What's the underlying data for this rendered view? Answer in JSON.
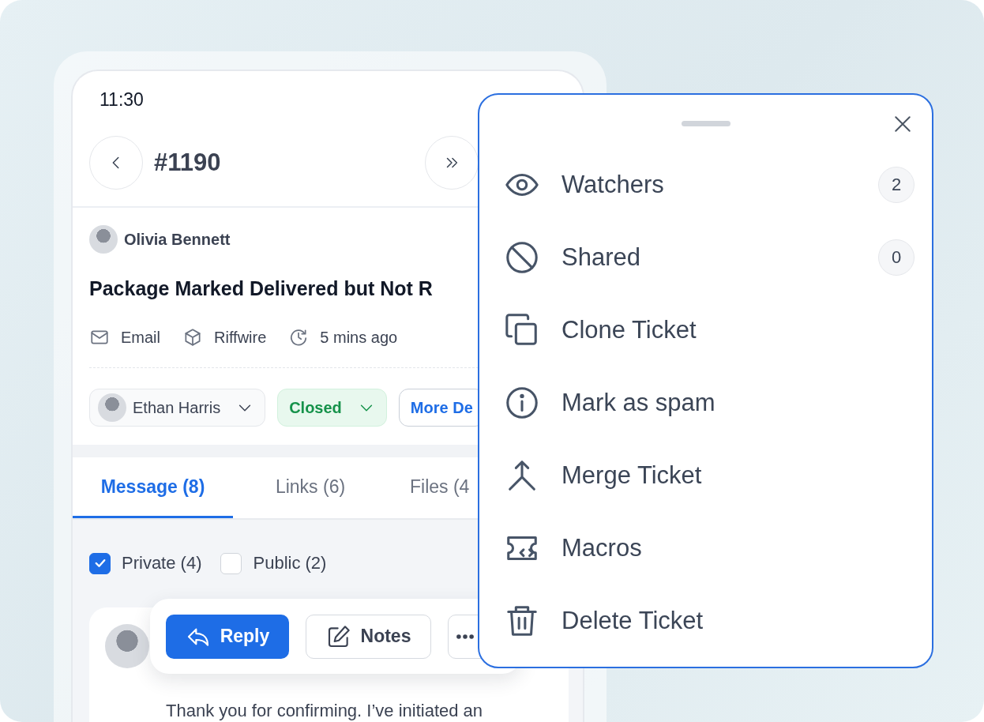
{
  "status_bar": {
    "time": "11:30"
  },
  "header": {
    "ticket_number": "#1190"
  },
  "ticket": {
    "requester": "Olivia Bennett",
    "subject": "Package Marked Delivered but Not R",
    "meta": [
      {
        "kind": "channel",
        "text": "Email"
      },
      {
        "kind": "brand",
        "text": "Riffwire"
      },
      {
        "kind": "time",
        "text": "5 mins ago"
      }
    ],
    "assignee": "Ethan Harris",
    "status": "Closed",
    "more_button": "More De"
  },
  "tabs": [
    {
      "label": "Message (8)",
      "selected": true
    },
    {
      "label": "Links (6)",
      "selected": false
    },
    {
      "label": "Files (4",
      "selected": false
    }
  ],
  "filters": [
    {
      "label": "Private (4)",
      "checked": true
    },
    {
      "label": "Public (2)",
      "checked": false
    }
  ],
  "toolbar": [
    {
      "kind": "reply",
      "label": "Reply"
    },
    {
      "kind": "notes",
      "label": "Notes"
    },
    {
      "kind": "more"
    }
  ],
  "message": {
    "text": "Thank you for confirming. I’ve initiated an"
  },
  "menu": {
    "items": [
      {
        "kind": "watchers",
        "label": "Watchers",
        "count": "2"
      },
      {
        "kind": "shared",
        "label": "Shared",
        "count": "0"
      },
      {
        "kind": "clone",
        "label": "Clone Ticket"
      },
      {
        "kind": "spam",
        "label": "Mark as spam"
      },
      {
        "kind": "merge",
        "label": "Merge Ticket"
      },
      {
        "kind": "macros",
        "label": "Macros"
      },
      {
        "kind": "delete",
        "label": "Delete Ticket"
      }
    ]
  }
}
